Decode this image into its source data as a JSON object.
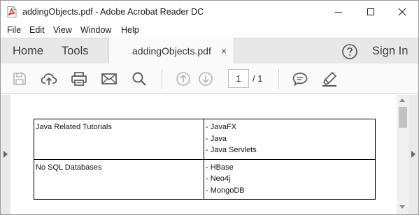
{
  "window": {
    "title": "addingObjects.pdf - Adobe Acrobat Reader DC",
    "icons": {
      "app": "pdf-file-icon",
      "minimize": "minimize-icon",
      "maximize": "maximize-icon",
      "close": "close-icon"
    }
  },
  "menu": {
    "items": [
      "File",
      "Edit",
      "View",
      "Window",
      "Help"
    ]
  },
  "tabs": {
    "home": "Home",
    "tools": "Tools",
    "document": "addingObjects.pdf",
    "close_glyph": "×",
    "help_icon": "help-circle-icon",
    "sign_in": "Sign In"
  },
  "toolbar": {
    "icons": [
      "save-icon",
      "cloud-upload-icon",
      "print-icon",
      "email-icon",
      "search-icon",
      "previous-page-icon",
      "next-page-icon",
      "comment-icon",
      "highlight-pen-icon"
    ],
    "current_page": "1",
    "total_pages": "/ 1"
  },
  "document": {
    "table": [
      {
        "left": "Java Related Tutorials",
        "right": [
          "- JavaFX",
          "- Java",
          "- Java Servlets"
        ]
      },
      {
        "left": "No SQL Databases",
        "right": [
          "- HBase",
          "- Neo4j",
          "- MongoDB"
        ]
      }
    ]
  },
  "colors": {
    "pdf_red": "#d4161c",
    "tab_bar": "#e8e8e8",
    "toolbar": "#fafafa",
    "icon_gray": "#5a5a5a",
    "disabled_icon": "#b5b5b5",
    "document_bg": "#d9d9d9"
  }
}
